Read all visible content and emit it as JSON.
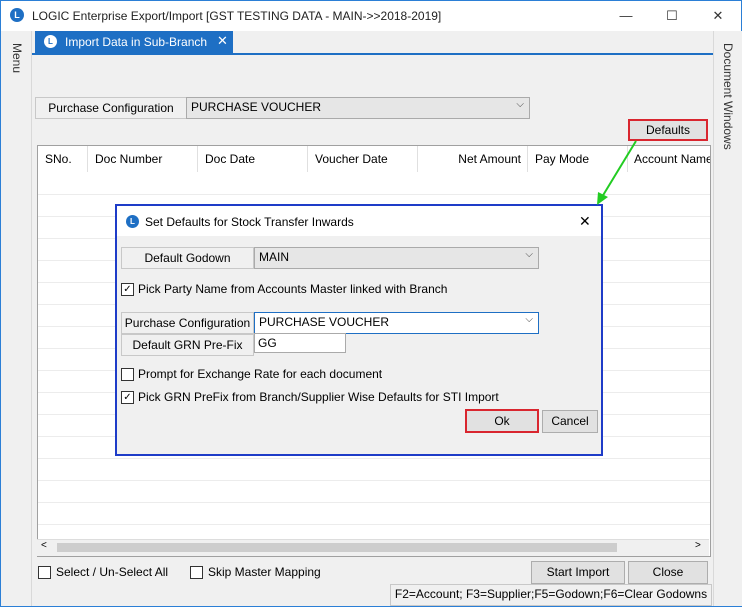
{
  "window": {
    "title": "LOGIC Enterprise Export/Import  [GST TESTING DATA - MAIN->>2018-2019]",
    "minimize": "—",
    "maximize": "☐",
    "close": "✕"
  },
  "left_rail": {
    "label": "Menu"
  },
  "right_rail": {
    "label": "Document Windows"
  },
  "tab": {
    "label": "Import Data in Sub-Branch",
    "close": "✕",
    "logo": "L"
  },
  "main": {
    "purchase_config_label": "Purchase Configuration",
    "purchase_config_value": "PURCHASE VOUCHER",
    "defaults_button": "Defaults",
    "columns": [
      "SNo.",
      "Doc Number",
      "Doc Date",
      "Voucher Date",
      "Net Amount",
      "Pay Mode",
      "Account Name"
    ],
    "select_all_label": "Select / Un-Select All",
    "skip_master_label": "Skip Master Mapping",
    "start_import_button": "Start Import",
    "close_button": "Close",
    "status_text": "F2=Account; F3=Supplier;F5=Godown;F6=Clear Godowns"
  },
  "dialog": {
    "title": "Set Defaults for Stock Transfer Inwards",
    "close": "✕",
    "default_godown_label": "Default Godown",
    "default_godown_value": "MAIN",
    "pick_party_label": "Pick Party Name from  Accounts Master linked with Branch",
    "pick_party_checked": true,
    "purchase_config_label": "Purchase Configuration",
    "purchase_config_value": "PURCHASE VOUCHER",
    "grn_prefix_label": "Default GRN Pre-Fix",
    "grn_prefix_value": "GG",
    "prompt_exchange_label": "Prompt for Exchange Rate for each document",
    "prompt_exchange_checked": false,
    "pick_grn_label": "Pick GRN PreFix from Branch/Supplier Wise Defaults for STI Import",
    "pick_grn_checked": true,
    "ok_button": "Ok",
    "cancel_button": "Cancel"
  },
  "icons": {
    "app_logo": "logic-logo-icon",
    "dropdown": "chevron-down-icon",
    "check": "checkmark-icon"
  },
  "colors": {
    "accent": "#1e6fc4",
    "highlight": "#d9262f",
    "dialog_border": "#1e3cc8",
    "arrow": "#22cc22"
  }
}
